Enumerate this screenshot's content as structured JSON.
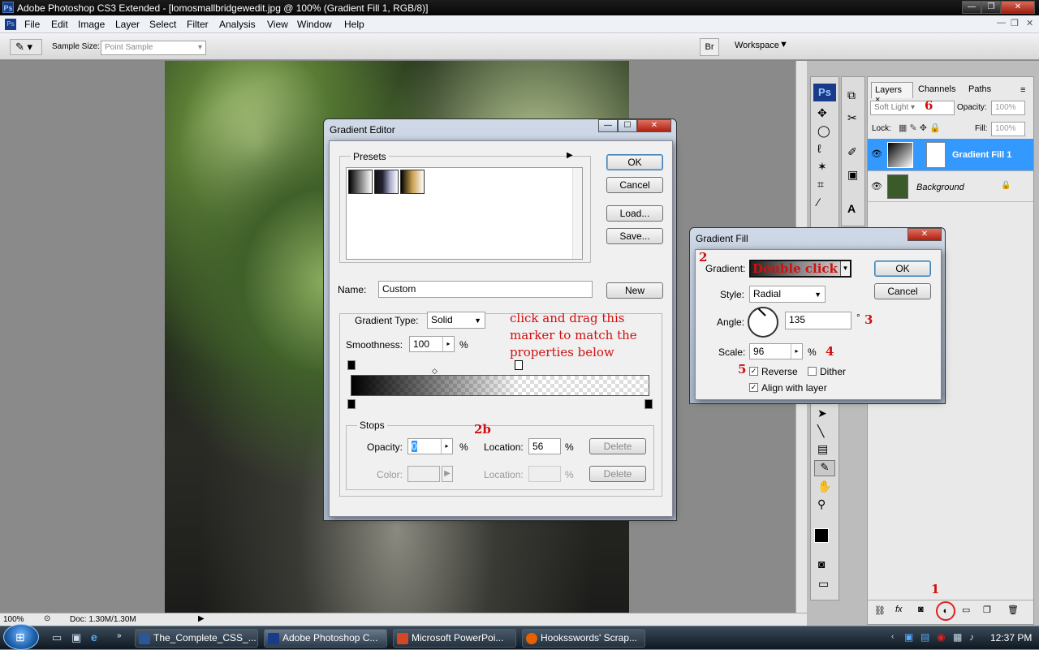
{
  "window": {
    "title": "Adobe Photoshop CS3 Extended - [lomosmallbridgewedit.jpg @ 100% (Gradient Fill 1, RGB/8)]",
    "app_icon": "Ps"
  },
  "menu": [
    "File",
    "Edit",
    "Image",
    "Layer",
    "Select",
    "Filter",
    "Analysis",
    "View",
    "Window",
    "Help"
  ],
  "options": {
    "sample_size_label": "Sample Size:",
    "sample_size_value": "Point Sample",
    "workspace_label": "Workspace"
  },
  "status": {
    "zoom": "100%",
    "doc": "Doc: 1.30M/1.30M"
  },
  "layers_panel": {
    "tabs": [
      "Layers",
      "Channels",
      "Paths"
    ],
    "blend_mode": "Soft Light",
    "opacity_label": "Opacity:",
    "opacity": "100%",
    "lock_label": "Lock:",
    "fill_label": "Fill:",
    "fill": "100%",
    "layers": [
      {
        "name": "Gradient Fill 1",
        "selected": true
      },
      {
        "name": "Background",
        "selected": false
      }
    ],
    "annotation_6": "6",
    "annotation_1": "1"
  },
  "gradient_editor": {
    "title": "Gradient Editor",
    "presets_label": "Presets",
    "ok": "OK",
    "cancel": "Cancel",
    "load": "Load...",
    "save": "Save...",
    "name_label": "Name:",
    "name_value": "Custom",
    "new_button": "New",
    "type_label": "Gradient Type:",
    "type_value": "Solid",
    "smoothness_label": "Smoothness:",
    "smoothness_value": "100",
    "pct": "%",
    "stops_label": "Stops",
    "opacity_label": "Opacity:",
    "opacity_value": "0",
    "location_label": "Location:",
    "location_value": "56",
    "delete": "Delete",
    "color_label": "Color:",
    "location2_label": "Location:",
    "delete2": "Delete",
    "note": "click and drag this marker to match the properties below",
    "annotation": "2b"
  },
  "gradient_fill": {
    "title": "Gradient Fill",
    "gradient_label": "Gradient:",
    "gradient_note": "Double click",
    "style_label": "Style:",
    "style_value": "Radial",
    "angle_label": "Angle:",
    "angle_value": "135",
    "degree": "°",
    "scale_label": "Scale:",
    "scale_value": "96",
    "pct": "%",
    "reverse": "Reverse",
    "dither": "Dither",
    "align": "Align with layer",
    "ok": "OK",
    "cancel": "Cancel",
    "a2": "2",
    "a3": "3",
    "a4": "4",
    "a5": "5"
  },
  "taskbar": {
    "items": [
      "The_Complete_CSS_...",
      "Adobe Photoshop C...",
      "Microsoft PowerPoi...",
      "Hooksswords' Scrap..."
    ],
    "time": "12:37 PM"
  },
  "colors": {
    "accent": "#3399ff",
    "annotation": "#d01010"
  }
}
